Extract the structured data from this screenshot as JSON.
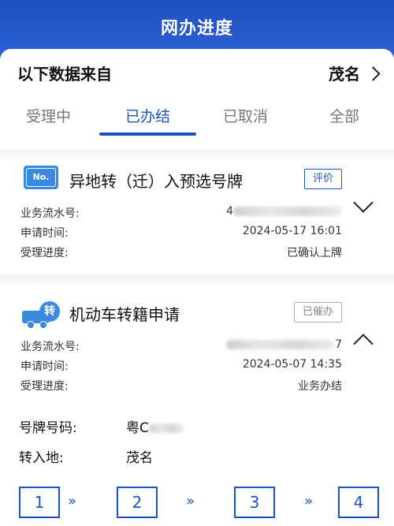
{
  "header": {
    "title": "网办进度"
  },
  "source": {
    "label": "以下数据来自",
    "city": "茂名"
  },
  "tabs": [
    "受理中",
    "已办结",
    "已取消",
    "全部"
  ],
  "cards": [
    {
      "plate_icon_text": "No.",
      "title": "异地转（迁）入预选号牌",
      "badge": "评价",
      "rows": [
        {
          "label": "业务流水号:",
          "value": "4"
        },
        {
          "label": "申请时间:",
          "value": "2024-05-17 16:01"
        },
        {
          "label": "受理进度:",
          "value": "已确认上牌"
        }
      ]
    },
    {
      "icon_text": "转",
      "title": "机动车转籍申请",
      "badge": "已催办",
      "rows": [
        {
          "label": "业务流水号:",
          "value": "7"
        },
        {
          "label": "申请时间:",
          "value": "2024-05-07 14:35"
        },
        {
          "label": "受理进度:",
          "value": "业务办结"
        }
      ],
      "details": [
        {
          "label": "号牌号码:",
          "value": "粤C"
        },
        {
          "label": "转入地:",
          "value": "茂名"
        }
      ],
      "steps": [
        "1",
        "2",
        "3",
        "4"
      ],
      "arrow": "»"
    }
  ],
  "colors": {
    "brand": "#1a54c4",
    "header": "#2d63d6"
  }
}
